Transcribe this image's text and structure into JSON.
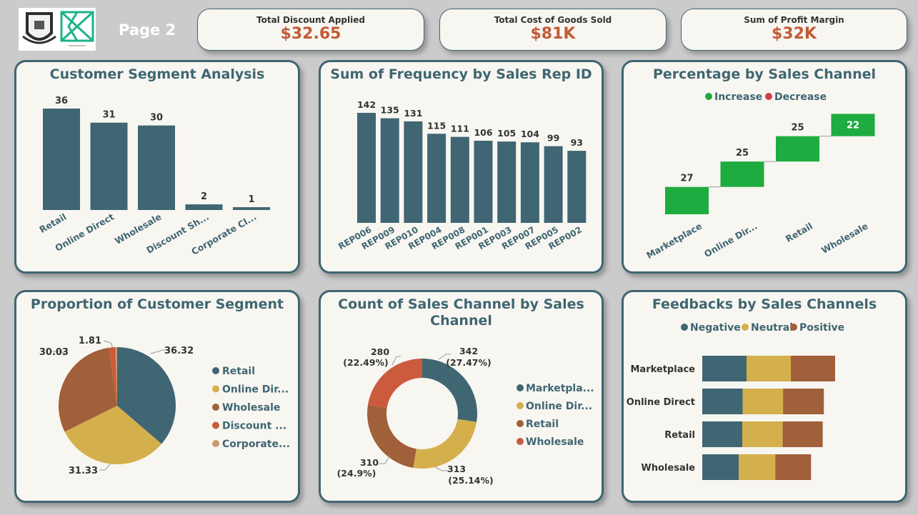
{
  "header": {
    "page_label": "Page 2",
    "kpis": [
      {
        "label": "Total Discount Applied",
        "value": "$32.65"
      },
      {
        "label": "Total Cost of Goods Sold",
        "value": "$81K"
      },
      {
        "label": "Sum of Profit Margin",
        "value": "$32K"
      }
    ]
  },
  "colors": {
    "teal": "#3f6672",
    "gold": "#d4b04c",
    "brown": "#a0603a",
    "orange": "#cb5b3c",
    "tan": "#c99a6b",
    "green": "#1eab3f",
    "red": "#d23c4e",
    "kpi_value": "#c25b36"
  },
  "charts": {
    "segment": {
      "title": "Customer Segment Analysis"
    },
    "rep": {
      "title": "Sum of Frequency by Sales Rep ID"
    },
    "waterfall": {
      "title": "Percentage by Sales Channel",
      "legend": [
        "Increase",
        "Decrease"
      ]
    },
    "prop": {
      "title": "Proportion of Customer Segment",
      "legend": [
        "Retail",
        "Online Dir...",
        "Wholesale",
        "Discount ...",
        "Corporate..."
      ]
    },
    "count": {
      "title": "Count of Sales Channel by Sales Channel",
      "legend": [
        "Marketpla...",
        "Online Dir...",
        "Retail",
        "Wholesale"
      ]
    },
    "feedback": {
      "title": "Feedbacks by Sales Channels",
      "legend": [
        "Negative",
        "Neutral",
        "Positive"
      ]
    }
  },
  "chart_data": [
    {
      "id": "segment",
      "type": "bar",
      "title": "Customer Segment Analysis",
      "categories": [
        "Retail",
        "Online Direct",
        "Wholesale",
        "Discount Sh...",
        "Corporate Cl..."
      ],
      "values": [
        36,
        31,
        30,
        2,
        1
      ],
      "ylim": [
        0,
        40
      ],
      "grid": false
    },
    {
      "id": "rep",
      "type": "bar",
      "title": "Sum of Frequency by Sales Rep ID",
      "categories": [
        "REP006",
        "REP009",
        "REP010",
        "REP004",
        "REP008",
        "REP001",
        "REP003",
        "REP007",
        "REP005",
        "REP002"
      ],
      "values": [
        142,
        135,
        131,
        115,
        111,
        106,
        105,
        104,
        99,
        93
      ],
      "ylim": [
        0,
        150
      ],
      "grid": false
    },
    {
      "id": "waterfall",
      "type": "bar",
      "subtype": "waterfall",
      "title": "Percentage by Sales Channel",
      "categories": [
        "Marketplace",
        "Online Dir...",
        "Retail",
        "Wholesale"
      ],
      "values": [
        27,
        25,
        25,
        22
      ],
      "legend": [
        "Increase",
        "Decrease"
      ],
      "legend_position": "top"
    },
    {
      "id": "prop",
      "type": "pie",
      "title": "Proportion of Customer Segment",
      "categories": [
        "Retail",
        "Online Dir...",
        "Wholesale",
        "Discount ...",
        "Corporate..."
      ],
      "values": [
        36.32,
        31.33,
        30.03,
        1.81,
        0.51
      ],
      "data_labels": [
        "36.32",
        "31.33",
        "30.03",
        "1.81"
      ],
      "legend_position": "right"
    },
    {
      "id": "count",
      "type": "pie",
      "subtype": "donut",
      "title": "Count of Sales Channel by Sales Channel",
      "categories": [
        "Marketpla...",
        "Online Dir...",
        "Retail",
        "Wholesale"
      ],
      "values": [
        342,
        313,
        310,
        280
      ],
      "label_counts": [
        "342",
        "313",
        "310",
        "280"
      ],
      "label_percents": [
        "(27.47%)",
        "(25.14%)",
        "(24.9%)",
        "(22.49%)"
      ],
      "legend_position": "right"
    },
    {
      "id": "feedback",
      "type": "bar",
      "subtype": "stacked-horizontal",
      "title": "Feedbacks by Sales Channels",
      "categories": [
        "Marketplace",
        "Online Direct",
        "Retail",
        "Wholesale"
      ],
      "series": [
        {
          "name": "Negative",
          "values": [
            114,
            104,
            103,
            94
          ]
        },
        {
          "name": "Neutral",
          "values": [
            114,
            104,
            104,
            94
          ]
        },
        {
          "name": "Positive",
          "values": [
            114,
            105,
            103,
            92
          ]
        }
      ],
      "xlim": [
        0,
        342
      ],
      "legend_position": "top"
    }
  ]
}
